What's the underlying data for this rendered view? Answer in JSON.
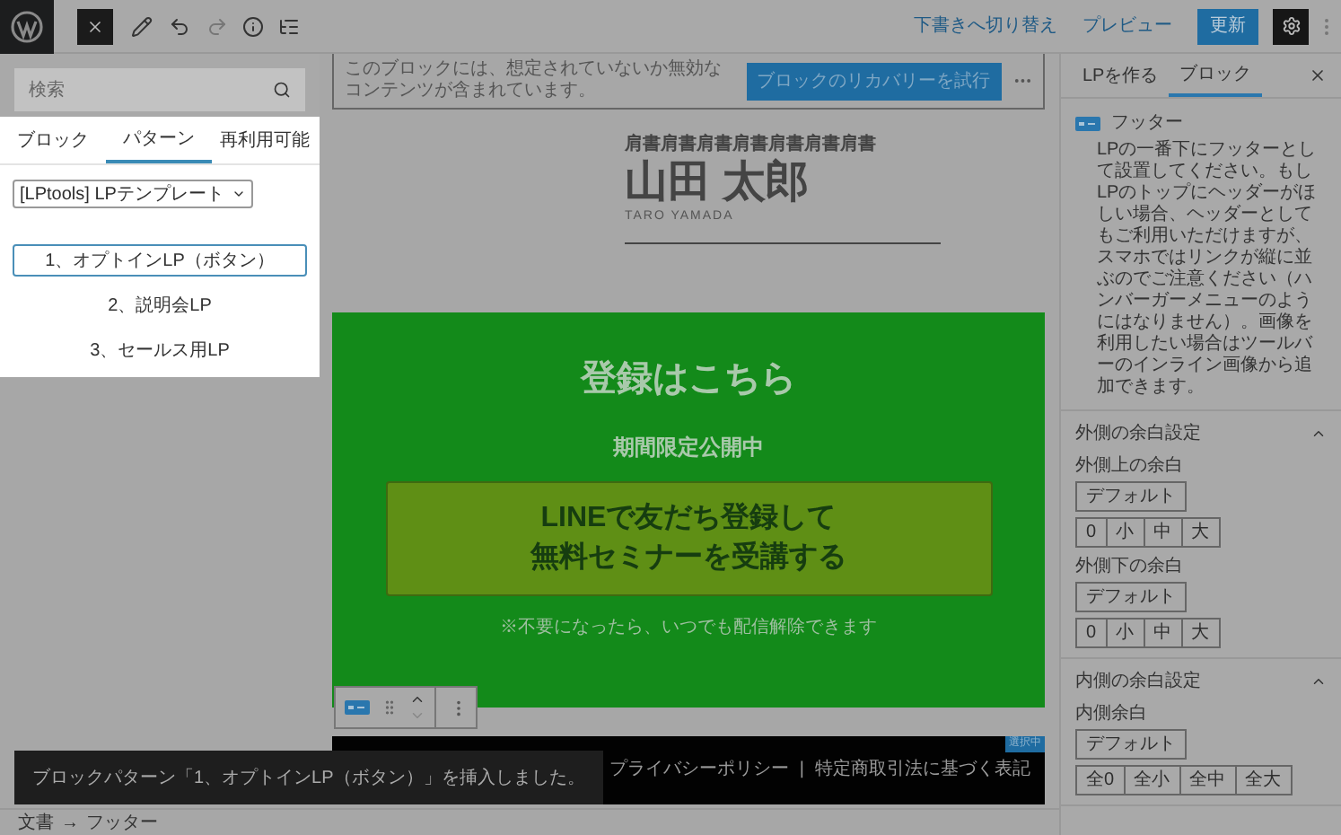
{
  "topbar": {
    "links": [
      "下書きへ切り替え",
      "プレビュー"
    ],
    "primary_button": "更新"
  },
  "inserter": {
    "search": {
      "placeholder": "検索"
    },
    "tabs": [
      {
        "label": "ブロック",
        "selected": false
      },
      {
        "label": "パターン",
        "selected": true
      },
      {
        "label": "再利用可能",
        "selected": false
      }
    ],
    "category": "[LPtools] LPテンプレート",
    "patterns": [
      {
        "label": "1、オプトインLP（ボタン）",
        "selected": true
      },
      {
        "label": "2、説明会LP",
        "selected": false
      },
      {
        "label": "3、セールス用LP",
        "selected": false
      }
    ]
  },
  "canvas": {
    "notice": {
      "text": "このブロックには、想定されていないか無効なコンテンツが含まれています。",
      "button": "ブロックのリカバリーを試行"
    },
    "header": {
      "title_line": "肩書肩書肩書肩書肩書肩書肩書",
      "name": "山田 太郎",
      "romaji": "TARO YAMADA"
    },
    "cta": {
      "heading": "登録はこちら",
      "subheading": "期間限定公開中",
      "button_lines": [
        "LINEで友だち登録して",
        "無料セミナーを受講する"
      ],
      "note": "※不要になったら、いつでも配信解除できます"
    },
    "footer": {
      "badge": "選択中",
      "links": [
        "プライバシーポリシー",
        "特定商取引法に基づく表記"
      ],
      "separator": "|"
    }
  },
  "snackbar": "ブロックパターン「1、オプトインLP（ボタン）」を挿入しました。",
  "breadcrumb": {
    "items": [
      "文書",
      "フッター"
    ],
    "separator": "→"
  },
  "sidebar": {
    "tabs": [
      {
        "label": "LPを作る",
        "selected": false
      },
      {
        "label": "ブロック",
        "selected": true
      }
    ],
    "block": {
      "name": "フッター",
      "description": "LPの一番下にフッターとして設置してください。もしLPのトップにヘッダーがほしい場合、ヘッダーとしてもご利用いただけますが、スマホではリンクが縦に並ぶのでご注意ください（ハンバーガーメニューのようにはなりません）。画像を利用したい場合はツールバーのインライン画像から追加できます。"
    },
    "sections": [
      {
        "title": "外側の余白設定",
        "expanded": true,
        "groups": [
          {
            "label": "外側上の余白",
            "default_button": "デフォルト",
            "options": [
              "0",
              "小",
              "中",
              "大"
            ]
          },
          {
            "label": "外側下の余白",
            "default_button": "デフォルト",
            "options": [
              "0",
              "小",
              "中",
              "大"
            ]
          }
        ]
      },
      {
        "title": "内側の余白設定",
        "expanded": true,
        "groups": [
          {
            "label": "内側余白",
            "default_button": "デフォルト",
            "options": [
              "全0",
              "全小",
              "全中",
              "全大"
            ]
          }
        ]
      }
    ]
  }
}
